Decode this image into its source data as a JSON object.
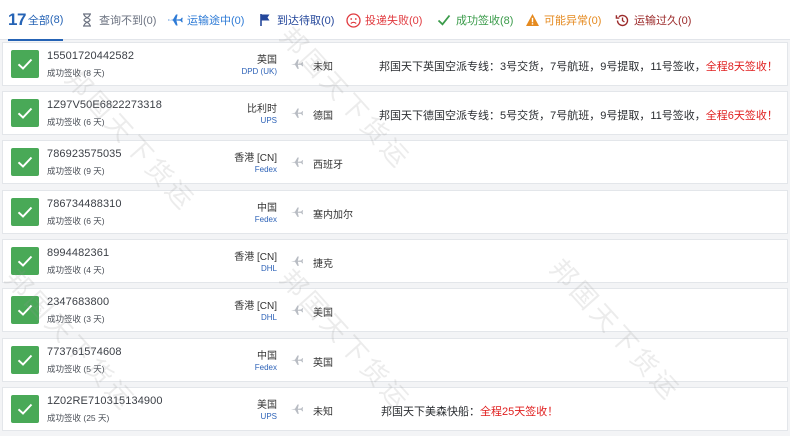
{
  "tabs": [
    {
      "label": "全部",
      "count_num": "17",
      "count_paren": "(8)",
      "icon": "count-number",
      "color": "#2563b5"
    },
    {
      "label": "查询不到(0)",
      "icon": "hourglass-icon",
      "color": "#6b7280"
    },
    {
      "label": "运输途中(0)",
      "icon": "airplane-icon",
      "color": "#2e7bd6"
    },
    {
      "label": "到达待取(0)",
      "icon": "flag-icon",
      "color": "#24479b"
    },
    {
      "label": "投递失败(0)",
      "icon": "sad-face-icon",
      "color": "#e0393e"
    },
    {
      "label": "成功签收(8)",
      "icon": "check-icon",
      "color": "#3a9b4a"
    },
    {
      "label": "可能异常(0)",
      "icon": "warning-icon",
      "color": "#e58a1f"
    },
    {
      "label": "运输过久(0)",
      "icon": "history-clock-icon",
      "color": "#9b2a2a"
    }
  ],
  "shipments": [
    {
      "number": "15501720442582",
      "status": "成功签收 (8 天)",
      "origin": "英国",
      "carrier": "DPD (UK)",
      "destination": "未知",
      "note": "邦国天下英国空派专线：3号交货，7号航班，9号提取，11号签收，",
      "note_red": "全程8天签收！"
    },
    {
      "number": "1Z97V50E6822273318",
      "status": "成功签收 (6 天)",
      "origin": "比利时",
      "carrier": "UPS",
      "destination": "德国",
      "note": "邦国天下德国空派专线：5号交货，7号航班，9号提取，11号签收，",
      "note_red": "全程6天签收！"
    },
    {
      "number": "786923575035",
      "status": "成功签收 (9 天)",
      "origin": "香港 [CN]",
      "carrier": "Fedex",
      "destination": "西班牙",
      "note": "",
      "note_red": ""
    },
    {
      "number": "786734488310",
      "status": "成功签收 (6 天)",
      "origin": "中国",
      "carrier": "Fedex",
      "destination": "塞内加尔",
      "note": "",
      "note_red": ""
    },
    {
      "number": "8994482361",
      "status": "成功签收 (4 天)",
      "origin": "香港 [CN]",
      "carrier": "DHL",
      "destination": "捷克",
      "note": "",
      "note_red": ""
    },
    {
      "number": "2347683800",
      "status": "成功签收 (3 天)",
      "origin": "香港 [CN]",
      "carrier": "DHL",
      "destination": "美国",
      "note": "",
      "note_red": ""
    },
    {
      "number": "773761574608",
      "status": "成功签收 (5 天)",
      "origin": "中国",
      "carrier": "Fedex",
      "destination": "英国",
      "note": "",
      "note_red": ""
    },
    {
      "number": "1Z02RE710315134900",
      "status": "成功签收 (25 天)",
      "origin": "美国",
      "carrier": "UPS",
      "destination": "未知",
      "note": "邦国天下美森快船：",
      "note_red": "全程25天签收！"
    }
  ],
  "watermark": "邦国天下货运",
  "colors": {
    "accent": "#2563b5",
    "success": "#49a957",
    "alert_red": "#e02020"
  }
}
